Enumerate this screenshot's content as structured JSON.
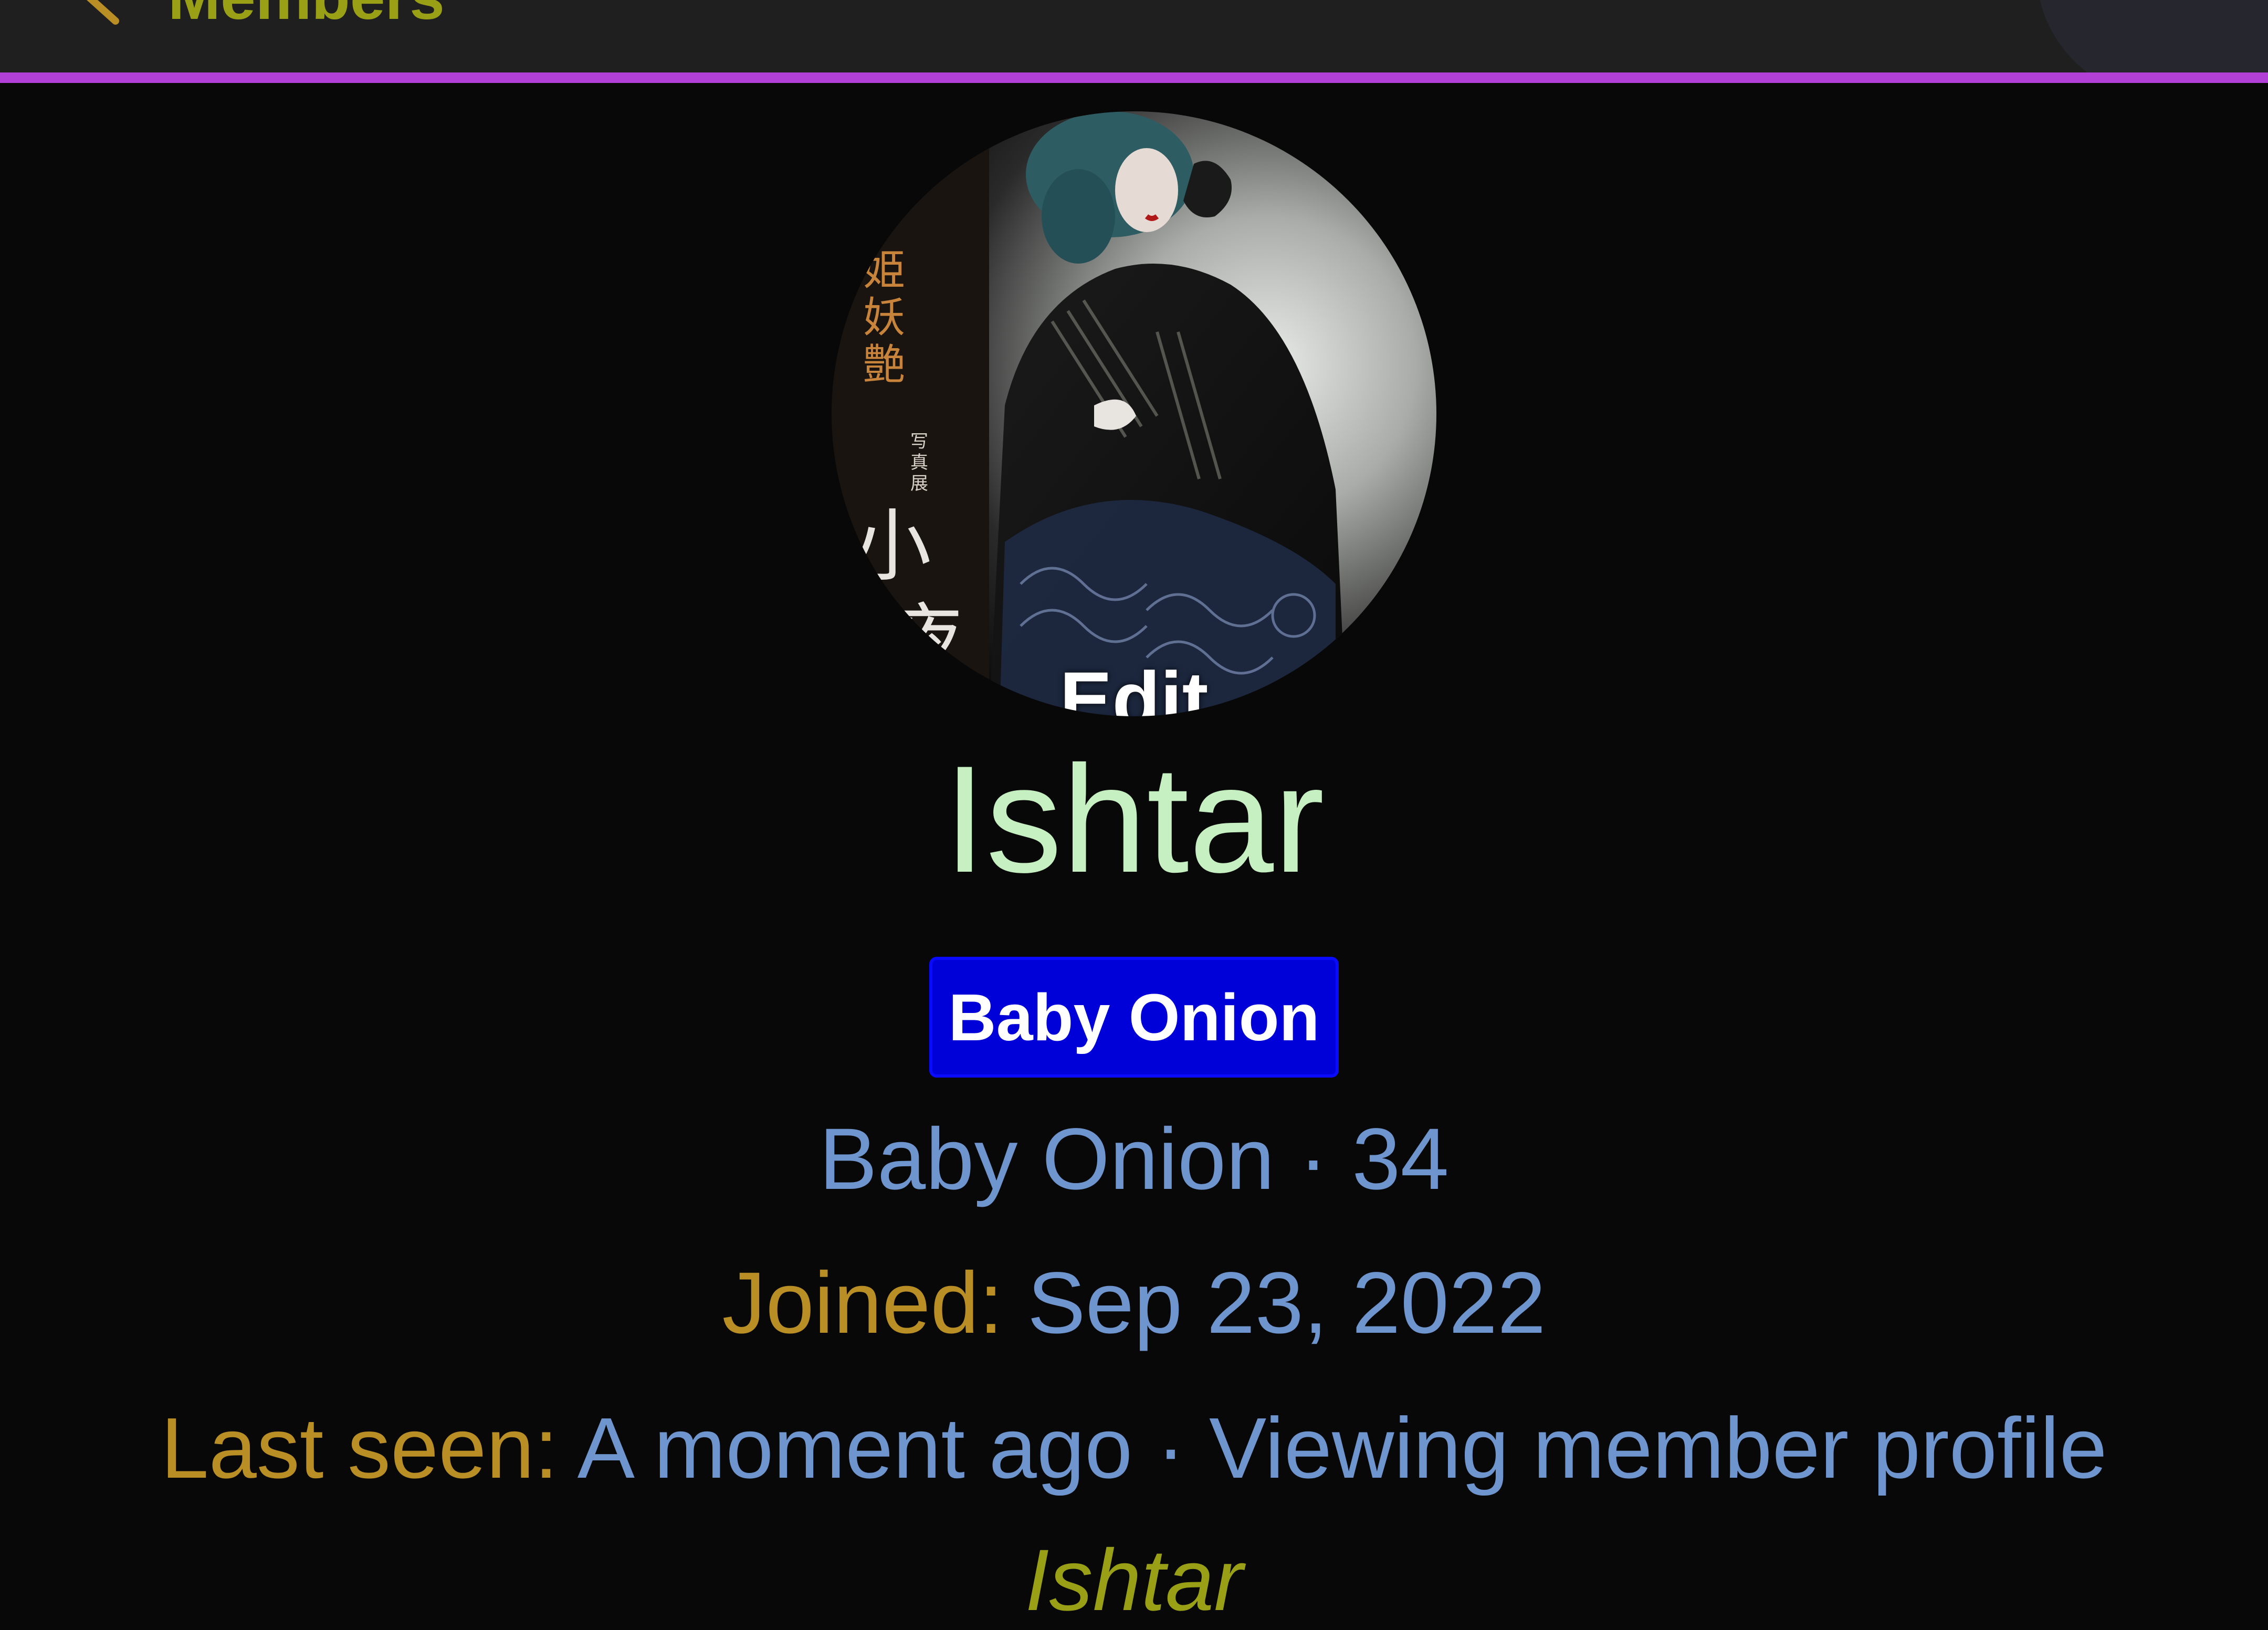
{
  "topbar": {
    "back_label": "Members",
    "accent_color": "#b23fd6",
    "back_icon": "chevron-left-icon"
  },
  "avatar": {
    "edit_label": "Edit",
    "image_lettering": "姫妖艶 写真展 小夜"
  },
  "profile": {
    "name": "Ishtar",
    "badge": "Baby Onion",
    "badge_color": "#0000d8",
    "rank_text": "Baby Onion · 34",
    "joined_label": "Joined:",
    "joined_value": "Sep 23, 2022",
    "last_seen_label": "Last seen:",
    "last_seen_value": "A moment ago · Viewing member profile",
    "viewing_name": "Ishtar"
  },
  "colors": {
    "name": "#c6f0c2",
    "label": "#b88e25",
    "value": "#6f95cf",
    "link": "#9aa016"
  }
}
